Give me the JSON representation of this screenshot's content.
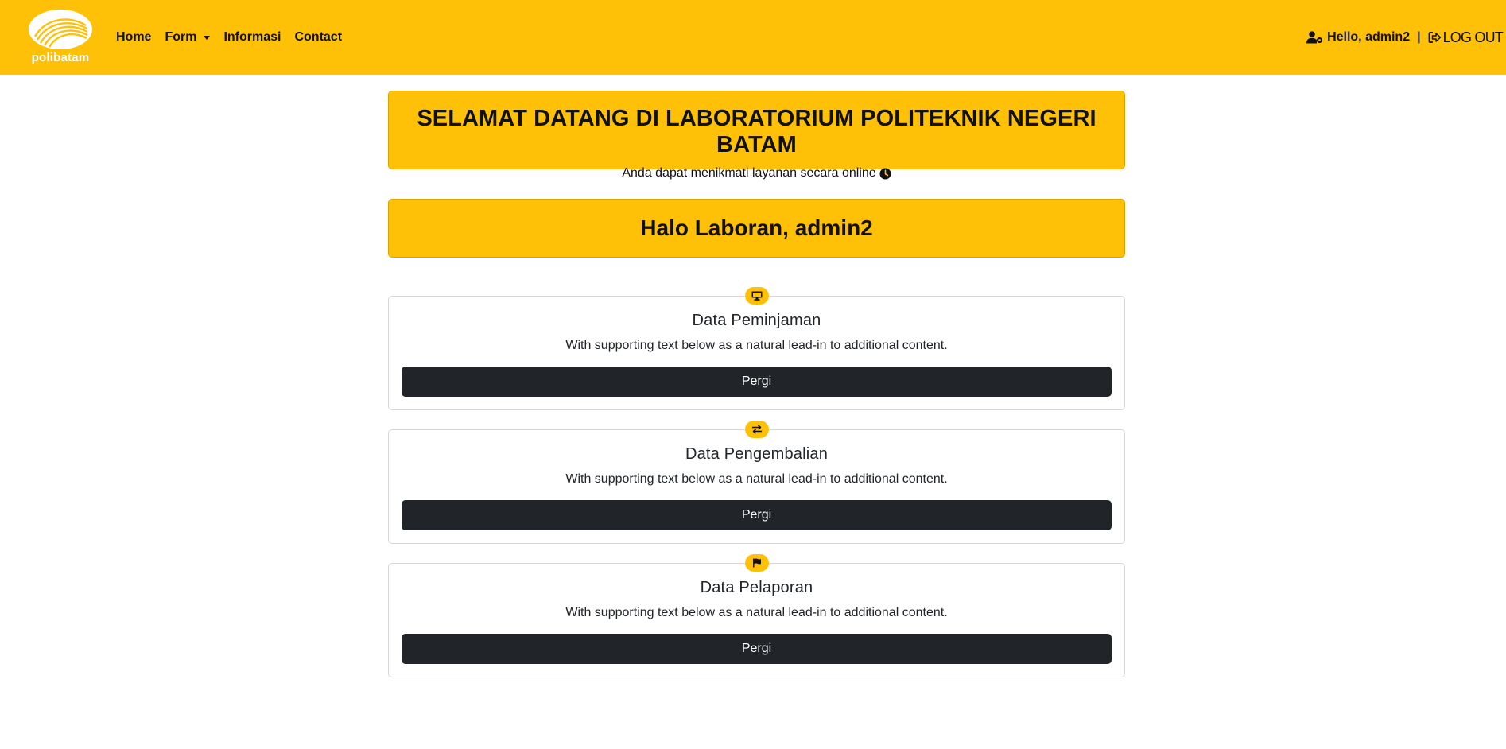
{
  "navbar": {
    "brand_text": "polibatam",
    "links": [
      {
        "label": "Home"
      },
      {
        "label": "Form"
      },
      {
        "label": "Informasi"
      },
      {
        "label": "Contact"
      }
    ],
    "user_greeting": "Hello, admin2",
    "separator": "|",
    "logout_label": "LOG OUT",
    "bg_color": "#ffc107"
  },
  "banner": {
    "title": "SELAMAT DATANG DI LABORATORIUM POLITEKNIK NEGERI BATAM",
    "subtitle": "Anda dapat menikmati layanan secara online",
    "subtitle_icon": "clock-icon"
  },
  "greeting": {
    "title": "Halo Laboran, admin2"
  },
  "cards": [
    {
      "icon": "desktop-icon",
      "title": "Data Peminjaman",
      "text": "With supporting text below as a natural lead-in to additional content.",
      "button": "Pergi"
    },
    {
      "icon": "exchange-arrows-icon",
      "title": "Data Pengembalian",
      "text": "With supporting text below as a natural lead-in to additional content.",
      "button": "Pergi"
    },
    {
      "icon": "flag-icon",
      "title": "Data Pelaporan",
      "text": "With supporting text below as a natural lead-in to additional content.",
      "button": "Pergi"
    }
  ]
}
